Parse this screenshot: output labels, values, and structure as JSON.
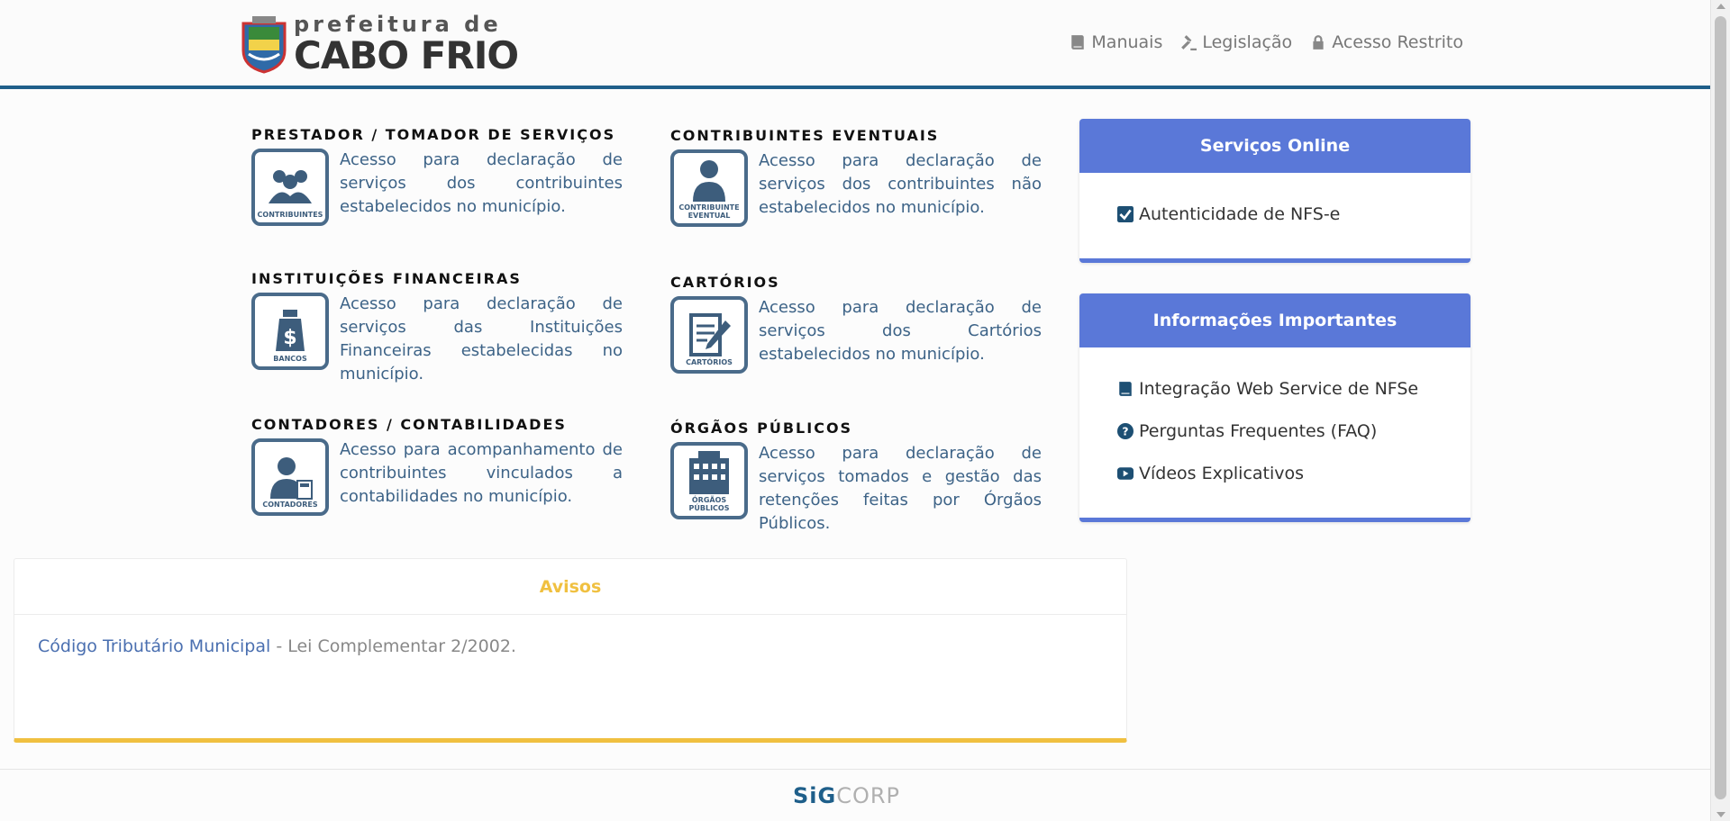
{
  "header": {
    "logo_small": "prefeitura de",
    "logo_big": "CABO FRIO",
    "nav": [
      {
        "label": "Manuais",
        "icon": "book-icon"
      },
      {
        "label": "Legislação",
        "icon": "gavel-icon"
      },
      {
        "label": "Acesso Restrito",
        "icon": "lock-icon"
      }
    ]
  },
  "tiles": {
    "prestador": {
      "title": "PRESTADOR / TOMADOR DE SERVIÇOS",
      "caption": "CONTRIBUINTES",
      "desc": "Acesso para declaração de serviços dos contribuintes estabelecidos no município."
    },
    "eventuais": {
      "title": "CONTRIBUINTES EVENTUAIS",
      "caption": "CONTRIBUINTE EVENTUAL",
      "desc": "Acesso para declaração de serviços dos contribuintes não estabelecidos no município."
    },
    "financeiras": {
      "title": "INSTITUIÇÕES FINANCEIRAS",
      "caption": "BANCOS",
      "desc": "Acesso para declaração de serviços das Instituições Financeiras estabelecidas no município."
    },
    "cartorios": {
      "title": "CARTÓRIOS",
      "caption": "CARTÓRIOS",
      "desc": "Acesso para declaração de serviços dos Cartórios estabelecidos no município."
    },
    "contadores": {
      "title": "CONTADORES / CONTABILIDADES",
      "caption": "CONTADORES",
      "desc": "Acesso para acompanhamento de contribuintes vinculados a contabilidades no município."
    },
    "orgaos": {
      "title": "ÓRGÃOS PÚBLICOS",
      "caption": "ÓRGÃOS PÚBLICOS",
      "desc": "Acesso para declaração de serviços tomados e gestão das retenções feitas por Órgãos Públicos."
    }
  },
  "servicos": {
    "title": "Serviços Online",
    "items": [
      {
        "label": "Autenticidade de NFS-e",
        "icon": "check-square-icon"
      }
    ]
  },
  "informacoes": {
    "title": "Informações Importantes",
    "items": [
      {
        "label": "Integração Web Service de NFSe",
        "icon": "book-icon"
      },
      {
        "label": "Perguntas Frequentes (FAQ)",
        "icon": "question-circle-icon"
      },
      {
        "label": "Vídeos Explicativos",
        "icon": "youtube-icon"
      }
    ]
  },
  "avisos": {
    "title": "Avisos",
    "link": "Código Tributário Municipal",
    "rest": " - Lei Complementar 2/2002."
  },
  "footer": {
    "brand_a": "SiG",
    "brand_b": "CORP"
  },
  "colors": {
    "primary": "#5a78d8",
    "header_rule": "#1f5f8a",
    "avisos_accent": "#f0c040",
    "icon_blue": "#3d6387"
  }
}
